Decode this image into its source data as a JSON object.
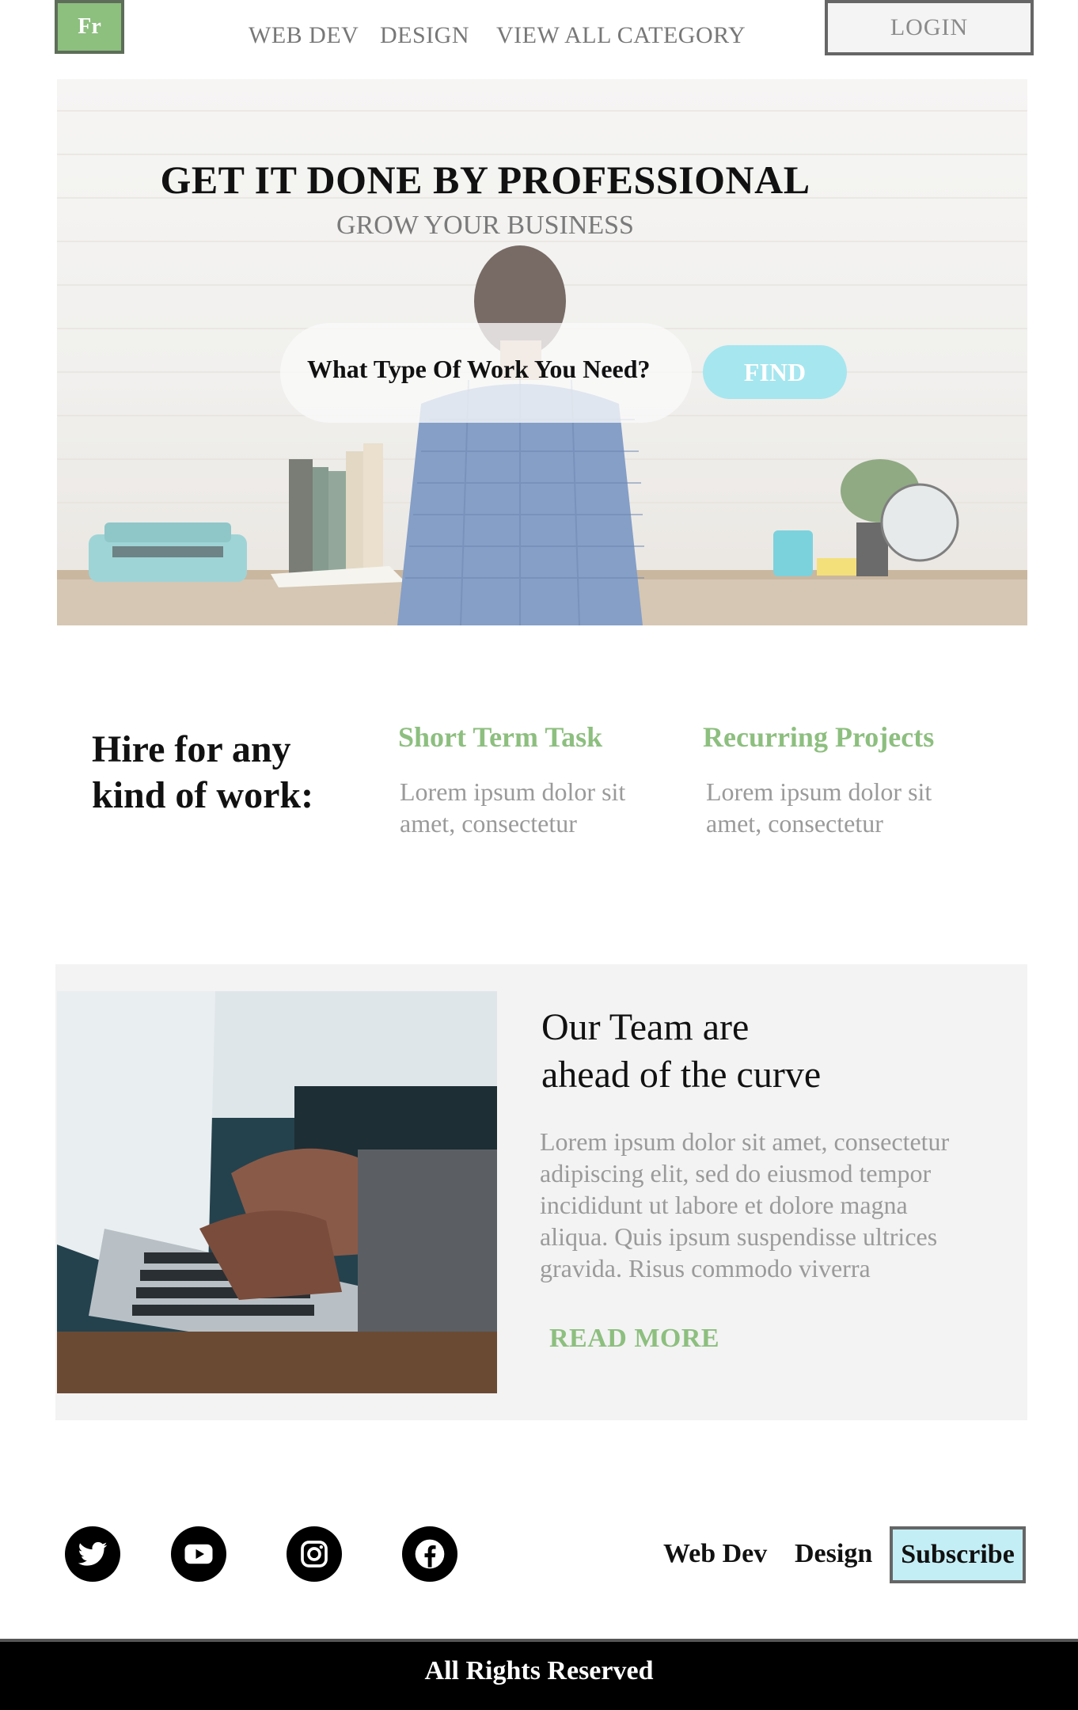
{
  "nav": {
    "logo": "Fr",
    "links": [
      "WEB DEV",
      "DESIGN",
      "VIEW ALL CATEGORY"
    ],
    "login": "LOGIN"
  },
  "hero": {
    "title": "GET IT DONE BY PROFESSIONAL",
    "subtitle": "GROW YOUR BUSINESS",
    "search_label": "What Type Of Work You Need?",
    "find_button": "FIND"
  },
  "hire": {
    "title_line1": "Hire for any",
    "title_line2": "kind of work:",
    "services": [
      {
        "title": "Short Term Task",
        "text_line1": "Lorem ipsum dolor sit",
        "text_line2": "amet, consectetur"
      },
      {
        "title": "Recurring Projects",
        "text_line1": "Lorem ipsum dolor sit",
        "text_line2": "amet, consectetur"
      }
    ]
  },
  "team": {
    "title_line1": "Our Team are",
    "title_line2": "ahead of the curve",
    "text_lines": [
      "Lorem ipsum dolor sit amet, consectetur",
      "adipiscing elit, sed do eiusmod tempor",
      "incididunt ut labore et dolore magna",
      "aliqua. Quis ipsum suspendisse ultrices",
      "gravida. Risus commodo viverra"
    ],
    "read_more": "READ MORE"
  },
  "footer": {
    "social_icons": [
      "twitter-icon",
      "youtube-icon",
      "instagram-icon",
      "facebook-icon"
    ],
    "links": [
      "Web Dev",
      "Design"
    ],
    "subscribe": "Subscribe",
    "copyright": "All Rights Reserved"
  },
  "colors": {
    "accent_green": "#8dbf7f",
    "accent_cyan": "#a6e6ef",
    "subscribe_bg": "#c4eef5",
    "gray_text": "#9a9a9a"
  }
}
